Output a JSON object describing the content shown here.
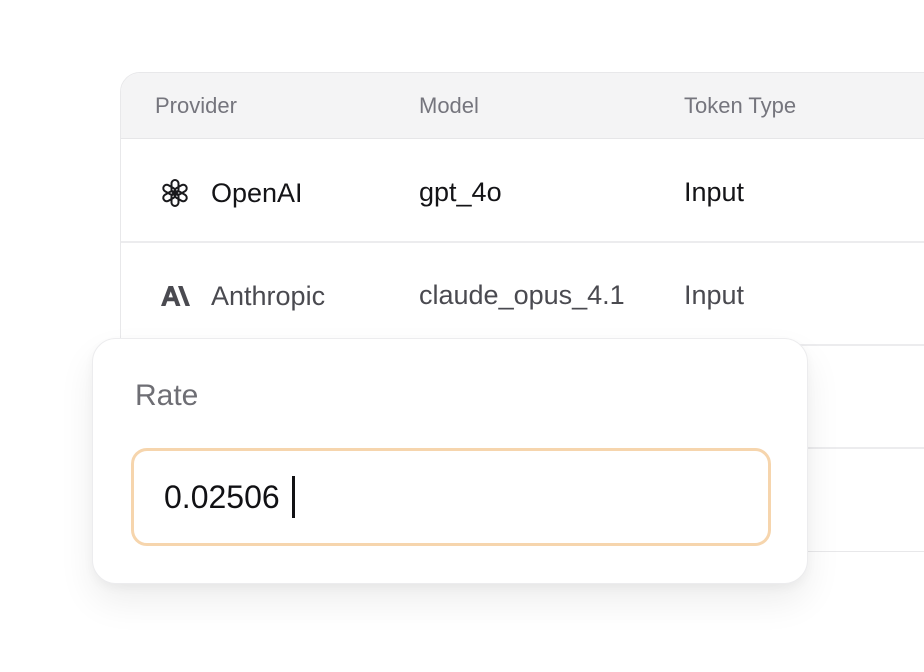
{
  "table": {
    "headers": {
      "provider": "Provider",
      "model": "Model",
      "token_type": "Token Type"
    },
    "rows": [
      {
        "provider": "OpenAI",
        "provider_icon": "openai-logo-icon",
        "model": "gpt_4o",
        "token_type": "Input"
      },
      {
        "provider": "Anthropic",
        "provider_icon": "anthropic-logo-icon",
        "model": "claude_opus_4.1",
        "token_type": "Input"
      }
    ]
  },
  "rate_popover": {
    "label": "Rate",
    "value": "0.02506"
  },
  "colors": {
    "header_bg": "#f4f4f5",
    "input_border_focus": "#f6d5ad",
    "border": "#e8e8ea"
  }
}
